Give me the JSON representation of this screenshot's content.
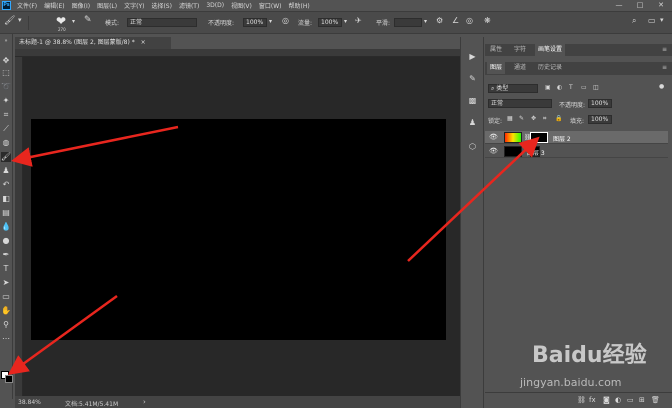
{
  "menu": {
    "logo": "Ps",
    "items": [
      "文件(F)",
      "编辑(E)",
      "图像(I)",
      "图层(L)",
      "文字(Y)",
      "选择(S)",
      "滤镜(T)",
      "3D(D)",
      "视图(V)",
      "窗口(W)",
      "帮助(H)"
    ],
    "minimize": "—",
    "maximize": "□",
    "close": "✕"
  },
  "options": {
    "brush_size": "270",
    "mode_label": "模式:",
    "mode_value": "正常",
    "opacity_label": "不透明度:",
    "opacity_value": "100%",
    "flow_label": "流量:",
    "flow_value": "100%",
    "smooth_label": "平滑:"
  },
  "document": {
    "tab_title": "未标题-1 @ 38.8% (图层 2, 图层蒙版/8) *",
    "tab_close": "×",
    "zoom": "38.84%",
    "doc_info": "文档:5.41M/5.41M"
  },
  "panels": {
    "top_tabs": [
      "属性",
      "字符",
      "画笔设置"
    ],
    "layer_tabs": [
      "图层",
      "通道",
      "历史记录"
    ],
    "filter_kind": "类型",
    "blend_mode": "正常",
    "opacity_label": "不透明度:",
    "opacity_value": "100%",
    "lock_label": "锁定:",
    "fill_label": "填充:",
    "fill_value": "100%",
    "layers": [
      {
        "name": "图层 2",
        "selected": true
      },
      {
        "name": "图层 3",
        "selected": false
      }
    ]
  },
  "watermark": {
    "brand": "Baidu经验",
    "url": "jingyan.baidu.com"
  },
  "colors": {
    "canvas_fill": "#000000",
    "workspace": "#282828",
    "accent": "#31a8ff",
    "arrow": "#e8261e"
  },
  "icons": [
    "brush-icon",
    "move-icon",
    "marquee-icon",
    "lasso-icon",
    "magic-wand-icon",
    "crop-icon",
    "eyedropper-icon",
    "healing-icon",
    "stamp-icon",
    "history-brush-icon",
    "eraser-icon",
    "gradient-icon",
    "blur-icon",
    "dodge-icon",
    "pen-icon",
    "type-icon",
    "path-select-icon",
    "shape-icon",
    "hand-icon",
    "zoom-icon"
  ]
}
